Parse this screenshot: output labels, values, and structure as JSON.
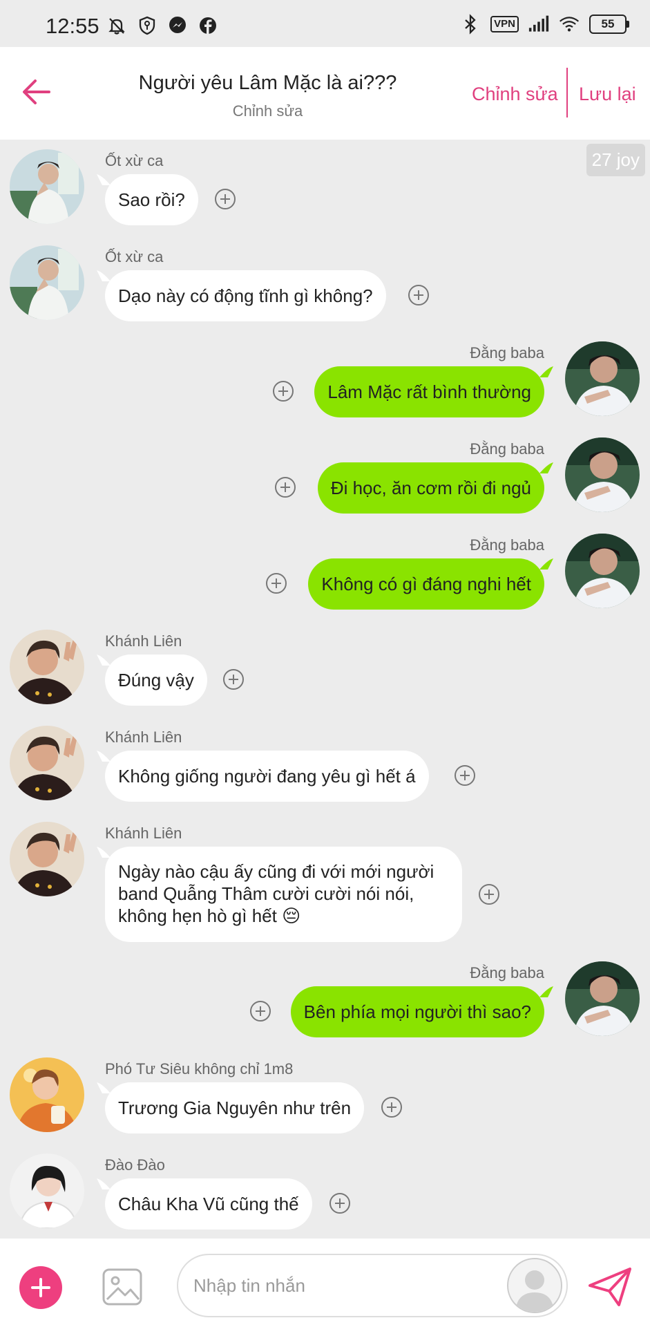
{
  "status_bar": {
    "time": "12:55",
    "left_icons": [
      "mute-icon",
      "shield-icon",
      "messenger-icon",
      "facebook-icon"
    ],
    "right_icons": [
      "bluetooth-icon",
      "vpn-icon",
      "signal-icon",
      "wifi-icon",
      "battery-icon"
    ],
    "vpn_label": "VPN",
    "battery": "55"
  },
  "header": {
    "title": "Người yêu Lâm Mặc là ai???",
    "subtitle": "Chỉnh sửa",
    "edit_label": "Chỉnh sửa",
    "save_label": "Lưu lại",
    "accent_color": "#e0407f"
  },
  "chat": {
    "joy_badge": "27 joy",
    "messages": [
      {
        "sender": "Ốt xừ ca",
        "direction": "in",
        "text": "Sao rồi?"
      },
      {
        "sender": "Ốt xừ ca",
        "direction": "in",
        "text": "Dạo này có động tĩnh gì không?"
      },
      {
        "sender": "Đằng baba",
        "direction": "out",
        "text": "Lâm Mặc rất bình thường"
      },
      {
        "sender": "Đằng baba",
        "direction": "out",
        "text": "Đi học, ăn cơm rồi đi ngủ"
      },
      {
        "sender": "Đằng baba",
        "direction": "out",
        "text": "Không có gì đáng nghi hết"
      },
      {
        "sender": "Khánh Liên",
        "direction": "in",
        "text": "Đúng vậy"
      },
      {
        "sender": "Khánh Liên",
        "direction": "in",
        "text": "Không giống người đang yêu gì hết á"
      },
      {
        "sender": "Khánh Liên",
        "direction": "in",
        "text": "Ngày nào cậu ấy cũng đi với mới người band Quẫng Thâm cười cười nói nói, không hẹn hò gì hết 😔"
      },
      {
        "sender": "Đằng baba",
        "direction": "out",
        "text": "Bên phía mọi người thì sao?"
      },
      {
        "sender": "Phó Tư Siêu không chỉ 1m8",
        "direction": "in",
        "text": "Trương Gia Nguyên như trên"
      },
      {
        "sender": "Đào Đào",
        "direction": "in",
        "text": "Châu Kha Vũ cũng thế"
      }
    ],
    "incoming_bubble_color": "#ffffff",
    "outgoing_bubble_color": "#8ae300"
  },
  "input_bar": {
    "placeholder": "Nhập tin nhắn",
    "add_color": "#ee3f7f"
  }
}
